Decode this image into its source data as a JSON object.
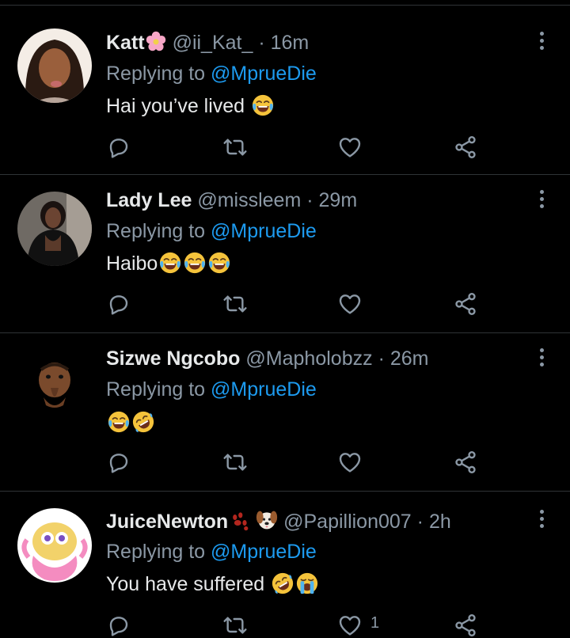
{
  "tweets": [
    {
      "name": "Katt",
      "handle": "@ii_Kat_",
      "dot": "·",
      "time": "16m",
      "replying_prefix": "Replying to ",
      "replying_to": "@MprueDie",
      "text": "Hai you’ve lived",
      "name_emoji": "cherry-blossom",
      "text_emoji": [
        "face-with-tears-of-joy"
      ]
    },
    {
      "name": "Lady Lee",
      "handle": "@missleem",
      "dot": "·",
      "time": "29m",
      "replying_prefix": "Replying to ",
      "replying_to": "@MprueDie",
      "text": "Haibo",
      "text_emoji": [
        "face-with-tears-of-joy",
        "face-with-tears-of-joy",
        "face-with-tears-of-joy"
      ]
    },
    {
      "name": "Sizwe Ngcobo",
      "handle": "@Mapholobzz",
      "dot": "·",
      "time": "26m",
      "replying_prefix": "Replying to ",
      "replying_to": "@MprueDie",
      "text": "",
      "text_emoji": [
        "face-with-tears-of-joy",
        "rolling-on-floor-laughing"
      ]
    },
    {
      "name": "JuiceNewton",
      "handle": "@Papillion007",
      "dot": "·",
      "time": "2h",
      "replying_prefix": "Replying to ",
      "replying_to": "@MprueDie",
      "text": "You have suffered",
      "name_emoji": [
        "paw-prints",
        "dog-face"
      ],
      "text_emoji": [
        "rolling-on-floor-laughing",
        "loudly-crying-face"
      ],
      "like_count": "1"
    }
  ],
  "icons": {
    "reply": "reply-icon",
    "retweet": "retweet-icon",
    "like": "like-icon",
    "share": "share-icon",
    "more": "more-options-icon"
  },
  "colors": {
    "background": "#000000",
    "text": "#e7e9ea",
    "secondary": "#8b98a5",
    "mention": "#1d9bf0",
    "divider": "#2f3336"
  }
}
